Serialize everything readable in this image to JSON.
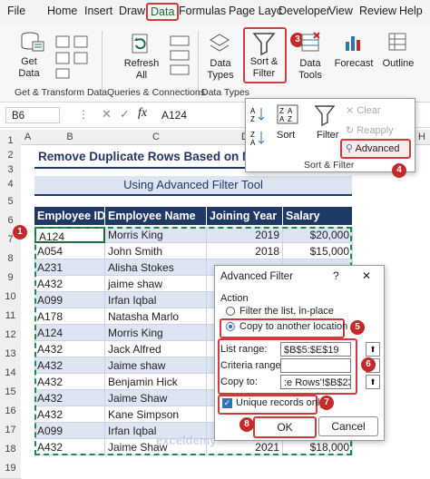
{
  "tabs": [
    "File",
    "Home",
    "Insert",
    "Draw",
    "Data",
    "Formulas",
    "Page Layc",
    "Developer",
    "View",
    "Review",
    "Help"
  ],
  "ribbon": {
    "get_data": "Get\nData",
    "refresh_all": "Refresh\nAll",
    "data_types": "Data\nTypes",
    "sort_filter": "Sort &\nFilter",
    "data_tools": "Data\nTools",
    "forecast": "Forecast",
    "outline": "Outline",
    "group1": "Get & Transform Data",
    "group2": "Queries & Connections",
    "group3": "Data Types"
  },
  "badges": [
    "1",
    "2",
    "3",
    "4",
    "5",
    "6",
    "7",
    "8"
  ],
  "formula_bar": {
    "name_box": "B6",
    "fx": "fx",
    "value": "A124"
  },
  "columns": [
    "A",
    "B",
    "C",
    "D",
    "E",
    "F",
    "G",
    "H"
  ],
  "rows": [
    "1",
    "2",
    "3",
    "4",
    "5",
    "6",
    "7",
    "8",
    "9",
    "10",
    "11",
    "12",
    "13",
    "14",
    "15",
    "16",
    "17",
    "18",
    "19"
  ],
  "sheet": {
    "title": "Remove Duplicate Rows Based on M",
    "subtitle": "Using Advanced Filter Tool",
    "headers": [
      "Employee ID",
      "Employee Name",
      "Joining Year",
      "Salary"
    ],
    "data": [
      [
        "A124",
        "Morris King",
        "2019",
        "$20,000"
      ],
      [
        "A054",
        "John Smith",
        "2018",
        "$15,000"
      ],
      [
        "A231",
        "Alisha Stokes",
        "",
        ""
      ],
      [
        "A432",
        "jaime shaw",
        "",
        ""
      ],
      [
        "A099",
        "Irfan Iqbal",
        "",
        ""
      ],
      [
        "A178",
        "Natasha Marlo",
        "",
        ""
      ],
      [
        "A124",
        "Morris King",
        "",
        ""
      ],
      [
        "A432",
        "Jack Alfred",
        "",
        ""
      ],
      [
        "A432",
        "Jaime shaw",
        "",
        ""
      ],
      [
        "A432",
        "Benjamin Hick",
        "",
        ""
      ],
      [
        "A432",
        "Jaime Shaw",
        "",
        ""
      ],
      [
        "A432",
        "Kane Simpson",
        "",
        ""
      ],
      [
        "A099",
        "Irfan Iqbal",
        "2020",
        "$15,000"
      ],
      [
        "A432",
        "Jaime Shaw",
        "2021",
        "$18,000"
      ]
    ]
  },
  "sort_popup": {
    "sort": "Sort",
    "filter": "Filter",
    "clear": "Clear",
    "reapply": "Reapply",
    "advanced": "Advanced",
    "group": "Sort & Filter"
  },
  "dialog": {
    "title": "Advanced Filter",
    "help": "?",
    "close": "✕",
    "action": "Action",
    "opt1": "Filter the list, in-place",
    "opt2": "Copy to another location",
    "list_range_label": "List range:",
    "list_range_value": "$B$5:$E$19",
    "criteria_label": "Criteria range:",
    "criteria_value": "",
    "copy_to_label": "Copy to:",
    "copy_to_value": ":e Rows'!$B$23",
    "unique": "Unique records only",
    "ok": "OK",
    "cancel": "Cancel"
  },
  "watermark": "exceldemy"
}
